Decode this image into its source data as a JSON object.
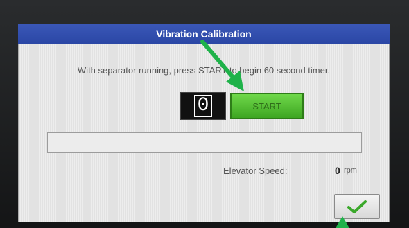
{
  "dialog": {
    "title": "Vibration Calibration",
    "instruction": "With separator running, press START to begin 60 second timer.",
    "counter_value": "0",
    "start_label": "START",
    "progress_fraction": 0,
    "elevator_speed_label": "Elevator Speed:",
    "elevator_speed_value": "0",
    "elevator_speed_unit": "rpm",
    "ok_icon": "checkmark-icon"
  },
  "colors": {
    "title_bar": "#2f4cab",
    "start_button": "#52be33",
    "annotation_arrow": "#1fb24a",
    "checkmark": "#3aa82a"
  }
}
